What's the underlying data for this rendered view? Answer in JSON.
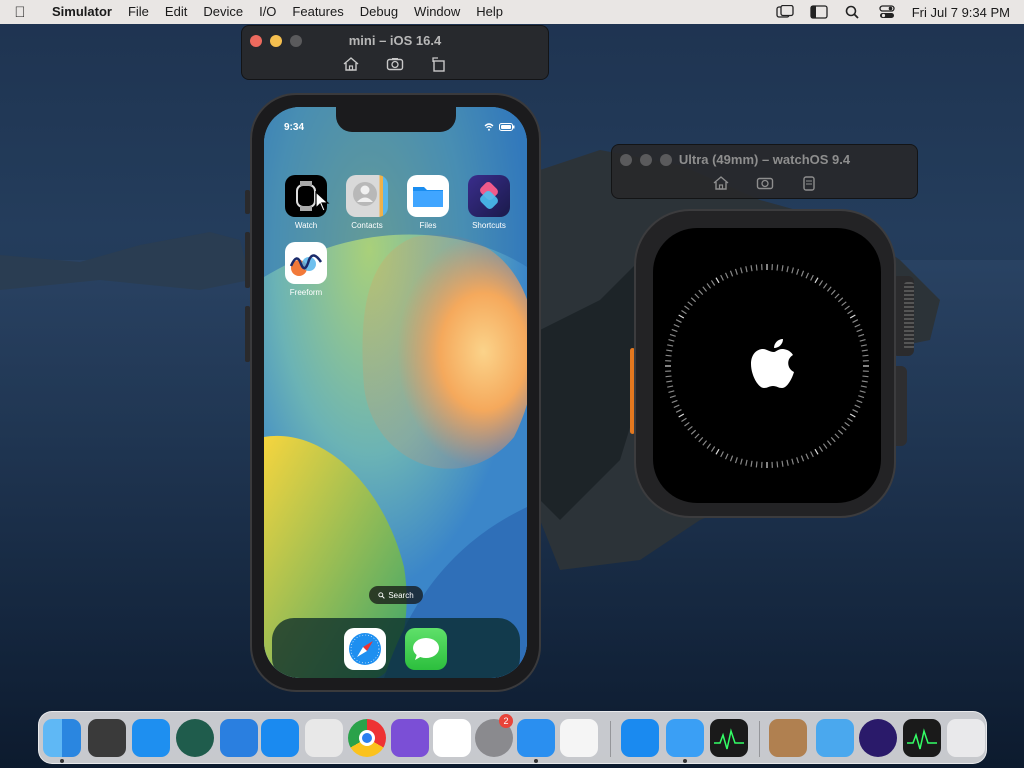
{
  "menubar": {
    "app_name": "Simulator",
    "menus": [
      "File",
      "Edit",
      "Device",
      "I/O",
      "Features",
      "Debug",
      "Window",
      "Help"
    ],
    "clock": "Fri Jul 7  9:34 PM"
  },
  "iphone_window": {
    "title": "mini – iOS 16.4",
    "tools": [
      "home-icon",
      "screenshot-icon",
      "rotate-icon"
    ]
  },
  "watch_window": {
    "title": "Ultra (49mm) – watchOS 9.4",
    "tools": [
      "home-icon",
      "screenshot-icon",
      "side-button-icon"
    ]
  },
  "iphone_screen": {
    "status_time": "9:34",
    "apps": [
      {
        "label": "Watch",
        "icon": "watch-app-icon"
      },
      {
        "label": "Contacts",
        "icon": "contacts-app-icon"
      },
      {
        "label": "Files",
        "icon": "files-app-icon"
      },
      {
        "label": "Shortcuts",
        "icon": "shortcuts-app-icon"
      },
      {
        "label": "Freeform",
        "icon": "freeform-app-icon"
      }
    ],
    "search_label": "Search",
    "dock_apps": [
      "safari-icon",
      "messages-icon"
    ]
  },
  "watch_screen": {
    "icon": "apple-logo-icon",
    "state": "booting"
  },
  "dock": {
    "items": [
      "finder-icon",
      "numbers-icon",
      "safari-icon",
      "time-machine-icon",
      "keynote-icon",
      "app-store-icon",
      "system-info-icon",
      "chrome-icon",
      "visual-studio-icon",
      "vscode-icon",
      "system-settings-icon",
      "simulator-icon",
      "launchpad-icon",
      "app-store-2-icon",
      "xcode-icon",
      "activity-monitor-icon",
      "archive-icon",
      "folder-icon",
      "firefox-icon",
      "activity-monitor-2-icon",
      "trash-icon"
    ],
    "settings_badge": "2"
  }
}
